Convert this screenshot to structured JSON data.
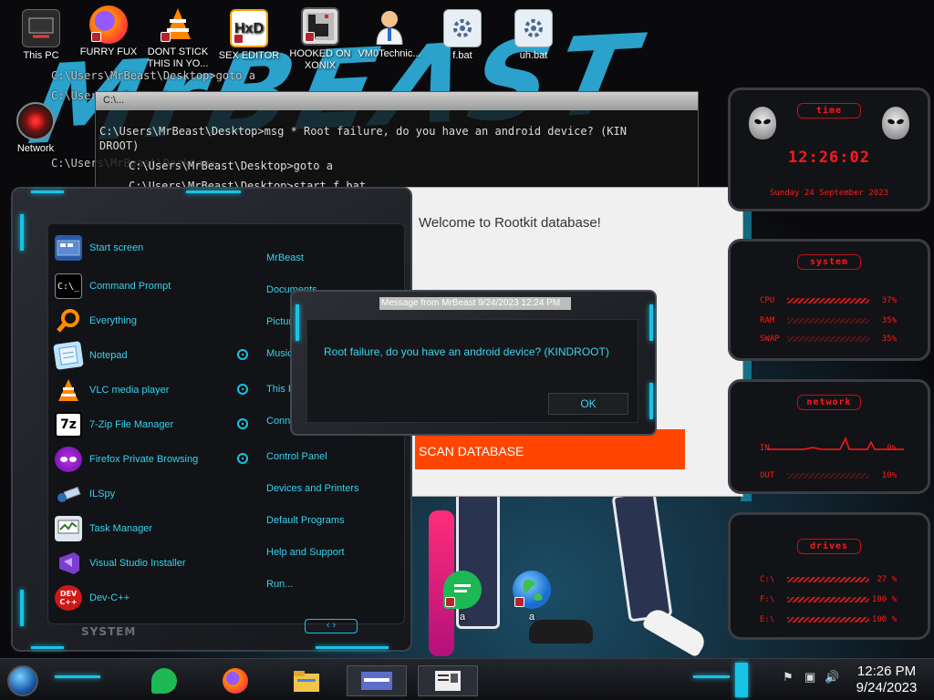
{
  "desktop_icons": [
    {
      "label": "This PC",
      "icon": "computer-icon"
    },
    {
      "label": "FURRY FUX",
      "icon": "firefox-icon"
    },
    {
      "label": "DONT STICK THIS IN YO...",
      "icon": "vlc-cone-icon"
    },
    {
      "label": "SEX EDITOR",
      "icon": "hxd-icon"
    },
    {
      "label": "HOOKED ON XONIX",
      "icon": "xonix-icon"
    },
    {
      "label": "VM0Technic...",
      "icon": "doctor-icon"
    },
    {
      "label": "f.bat",
      "icon": "batch-gear-icon"
    },
    {
      "label": "uh.bat",
      "icon": "batch-gear-icon"
    },
    {
      "label": "Network",
      "icon": "network-icon"
    },
    {
      "label": "a",
      "icon": "notepad-green-icon"
    },
    {
      "label": "a",
      "icon": "globe-icon"
    }
  ],
  "console": {
    "title": "C:\\...",
    "lines": [
      "C:\\Users\\MrBeast\\Desktop>msg * Root failure, do you have an android device? (KIN",
      "DROOT)",
      "C:\\Users\\MrBeast\\Desktop>goto a",
      "C:\\Users\\MrBeast\\Desktop>start f.bat"
    ],
    "ghost_lines": [
      "C:\\Users\\MrBeast\\Desktop>goto a",
      "C:\\Users\\MrBeast\\Desktop>",
      "C:\\Users\\MrBeast\\Desktop>"
    ]
  },
  "scan_window": {
    "heading": "Welcome to Rootkit database!",
    "scan_button": "SCAN DATABASE"
  },
  "message_box": {
    "title": "Message from MrBeast 9/24/2023 12:24 PM",
    "text": "Root failure, do you have an android device? (KINDROOT)",
    "ok": "OK"
  },
  "start_menu": {
    "left_items": [
      {
        "label": "Start screen",
        "icon": "start-screen-icon",
        "submenu": false
      },
      {
        "label": "Command Prompt",
        "icon": "cmd-icon",
        "submenu": false
      },
      {
        "label": "Everything",
        "icon": "magnifier-icon",
        "submenu": false
      },
      {
        "label": "Notepad",
        "icon": "notepad-icon",
        "submenu": true
      },
      {
        "label": "VLC media player",
        "icon": "vlc-icon",
        "submenu": true
      },
      {
        "label": "7-Zip File Manager",
        "icon": "7zip-icon",
        "submenu": true
      },
      {
        "label": "Firefox Private Browsing",
        "icon": "firefox-private-icon",
        "submenu": true
      },
      {
        "label": "ILSpy",
        "icon": "ilspy-icon",
        "submenu": false
      },
      {
        "label": "Task Manager",
        "icon": "task-manager-icon",
        "submenu": false
      },
      {
        "label": "Visual Studio Installer",
        "icon": "visual-studio-icon",
        "submenu": false
      },
      {
        "label": "Dev-C++",
        "icon": "devcpp-icon",
        "submenu": false
      }
    ],
    "right_items": [
      "MrBeast",
      "Documents",
      "Pictures",
      "Music",
      "This PC",
      "Connect To",
      "Control Panel",
      "Devices and Printers",
      "Default Programs",
      "Help and Support",
      "Run..."
    ],
    "footer_label": "SYSTEM",
    "nav_glyph": "‹ ›"
  },
  "gadgets": {
    "time": {
      "header": "TIME",
      "clock": "12:26:02",
      "date": "Sunday 24 September 2023"
    },
    "system": {
      "header": "SYSTEM",
      "rows": [
        {
          "label": "CPU",
          "value": "37%"
        },
        {
          "label": "RAM",
          "value": "35%"
        },
        {
          "label": "SWAP",
          "value": "35%"
        }
      ]
    },
    "network": {
      "header": "NETWORK",
      "rows": [
        {
          "label": "IN",
          "value": "0%"
        },
        {
          "label": "OUT",
          "value": "10%"
        }
      ]
    },
    "drives": {
      "header": "DRIVES",
      "rows": [
        {
          "label": "C:\\",
          "value": "27 %"
        },
        {
          "label": "F:\\",
          "value": "100 %"
        },
        {
          "label": "E:\\",
          "value": "100 %"
        }
      ]
    }
  },
  "taskbar": {
    "apps": [
      "notepad-green-icon",
      "firefox-icon",
      "file-explorer-icon",
      "window-thumbnail-icon",
      "window-thumbnail-icon"
    ],
    "time": "12:26 PM",
    "date": "9/24/2023"
  },
  "colors": {
    "accent_cyan": "#17c4e6",
    "gadget_red": "#ff1a1a",
    "scan_orange": "#ff4500"
  }
}
